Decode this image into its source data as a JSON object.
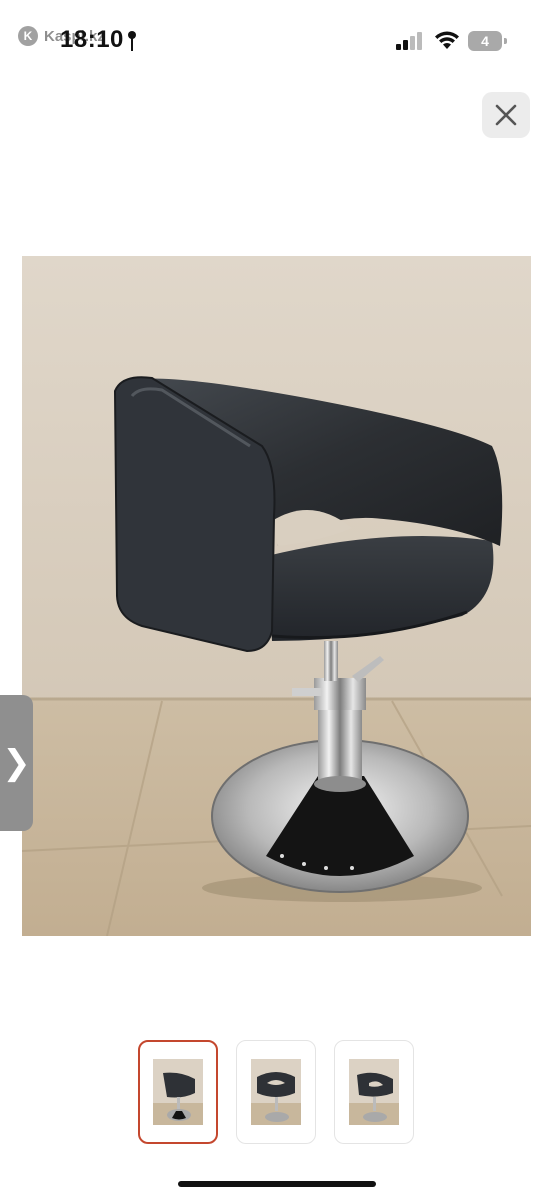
{
  "status_bar": {
    "app_logo_letter": "K",
    "app_name": "Kaspi.kz",
    "time": "18:10",
    "battery_level": "4",
    "icons": [
      "location-icon",
      "cellular-signal-icon",
      "wifi-icon",
      "battery-icon"
    ]
  },
  "viewer": {
    "close_icon": "close-icon",
    "next_icon": "chevron-right-icon",
    "next_glyph": "❯",
    "selected_thumbnail_index": 0,
    "thumbnail_count": 3
  },
  "colors": {
    "selected_border": "#c4472e",
    "handle": "#8f8f8f",
    "close_bg": "#ececec",
    "wall": "#d9cfc0",
    "floor": "#c9b79d",
    "chair_leather": "#2f3236"
  }
}
